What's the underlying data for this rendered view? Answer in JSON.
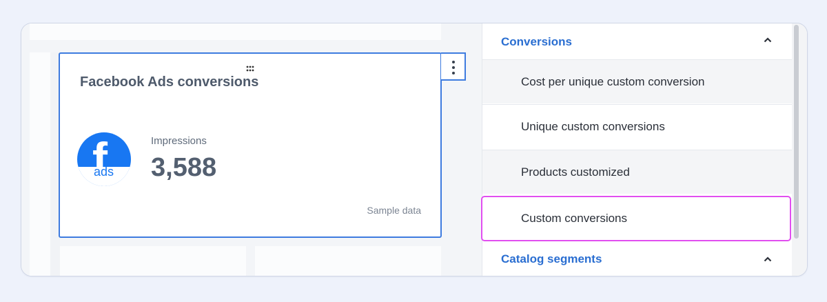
{
  "widget": {
    "title": "Facebook Ads conversions",
    "logo_text": "ads",
    "metric_label": "Impressions",
    "metric_value": "3,588",
    "footnote": "Sample data"
  },
  "panel": {
    "sections": [
      {
        "title": "Conversions",
        "expanded": true,
        "items": [
          "Cost per unique custom conversion",
          "Unique custom conversions",
          "Products customized",
          "Custom conversions"
        ],
        "highlighted_item": "Custom conversions"
      },
      {
        "title": "Catalog segments",
        "expanded": true
      }
    ]
  },
  "colors": {
    "accent_blue": "#3d7bdf",
    "section_blue": "#2a6ed1",
    "facebook_blue": "#1877f2",
    "highlight_magenta": "#e14ef0"
  },
  "icons": [
    "drag-handle-icon",
    "kebab-menu-icon",
    "chevron-up-icon",
    "facebook-ads-logo"
  ]
}
